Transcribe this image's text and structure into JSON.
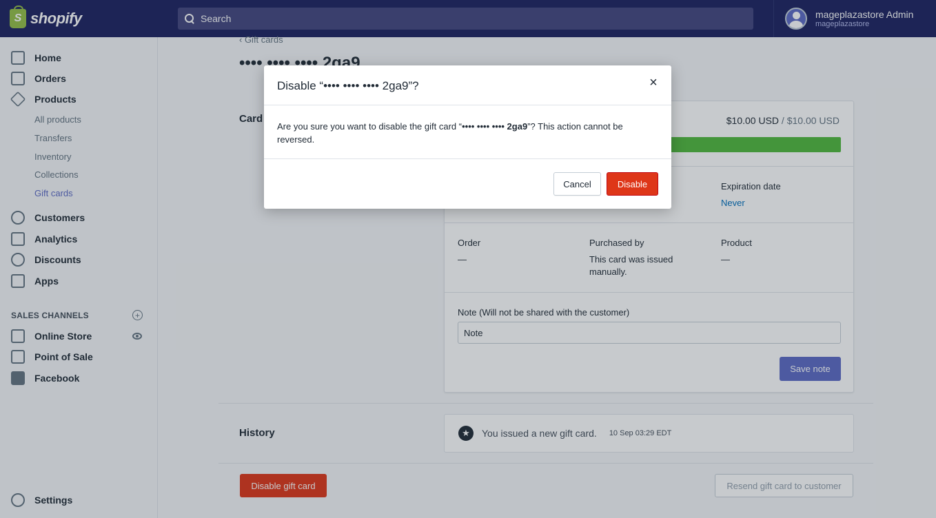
{
  "brand": {
    "name": "shopify",
    "bag_letter": "S"
  },
  "search": {
    "placeholder": "Search"
  },
  "user": {
    "name": "mageplazastore Admin",
    "store": "mageplazastore"
  },
  "sidebar": {
    "items": [
      {
        "label": "Home"
      },
      {
        "label": "Orders"
      },
      {
        "label": "Products"
      }
    ],
    "sub_items": [
      {
        "label": "All products"
      },
      {
        "label": "Transfers"
      },
      {
        "label": "Inventory"
      },
      {
        "label": "Collections"
      },
      {
        "label": "Gift cards"
      }
    ],
    "items2": [
      {
        "label": "Customers"
      },
      {
        "label": "Analytics"
      },
      {
        "label": "Discounts"
      },
      {
        "label": "Apps"
      }
    ],
    "sales_channels_title": "SALES CHANNELS",
    "add_symbol": "+",
    "channels": [
      {
        "label": "Online Store"
      },
      {
        "label": "Point of Sale"
      },
      {
        "label": "Facebook"
      }
    ],
    "settings": "Settings"
  },
  "page": {
    "back": "‹ Gift cards",
    "title": "•••• •••• •••• 2ga9",
    "card_section": "Card",
    "balance": "$10.00 USD",
    "balance_sep": " / ",
    "balance_total": "$10.00 USD",
    "expiration_label": "Expiration date",
    "expiration_value": "Never",
    "order_label": "Order",
    "order_value": "—",
    "purchased_label": "Purchased by",
    "purchased_value": "This card was issued manually.",
    "product_label": "Product",
    "product_value": "—",
    "note_label": "Note (Will not be shared with the customer)",
    "note_placeholder": "Note",
    "save_note": "Save note",
    "history_section": "History",
    "history_text": "You issued a new gift card.",
    "history_time": "10 Sep 03:29  EDT",
    "disable_card": "Disable gift card",
    "resend": "Resend gift card to customer"
  },
  "modal": {
    "title": "Disable “•••• •••• •••• 2ga9”?",
    "close": "×",
    "body_prefix": "Are you sure you want to disable the gift card “",
    "body_code": "•••• •••• •••• 2ga9",
    "body_suffix": "”? This action cannot be reversed.",
    "cancel": "Cancel",
    "confirm": "Disable"
  },
  "colors": {
    "topbar": "#1c2260",
    "primary": "#5c6ac4",
    "destructive": "#de3618",
    "progress": "#50b83c",
    "link": "#006fbb"
  }
}
